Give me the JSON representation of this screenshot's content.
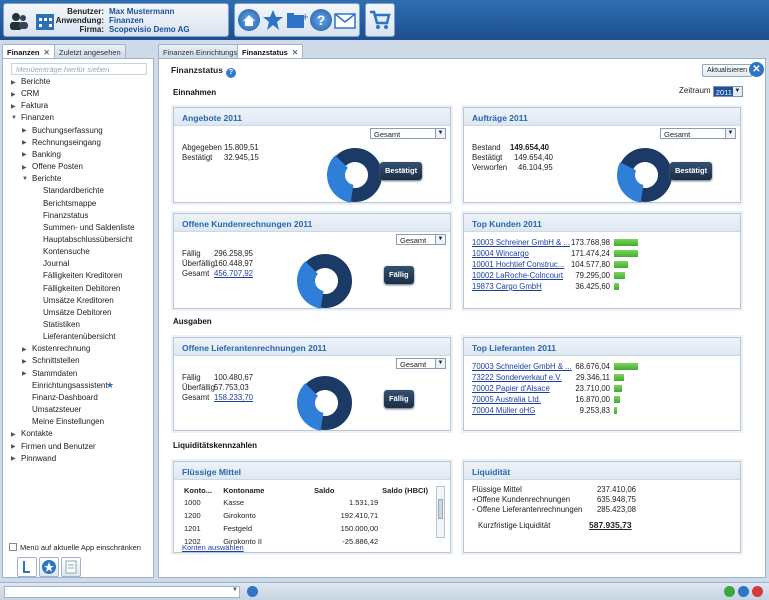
{
  "user": {
    "benutzer_label": "Benutzer:",
    "benutzer": "Max Mustermann",
    "anwendung_label": "Anwendung:",
    "anwendung": "Finanzen",
    "firma_label": "Firma:",
    "firma": "Scopevisio Demo AG"
  },
  "left_tabs": [
    {
      "label": "Finanzen",
      "active": true
    },
    {
      "label": "Zuletzt angesehen",
      "active": false
    }
  ],
  "main_tabs": [
    {
      "label": "Finanzen Einrichtungs...",
      "active": false
    },
    {
      "label": "Finanzstatus",
      "active": true
    }
  ],
  "menu": {
    "search_placeholder": "Menüeinträge hierfür sieben",
    "items": [
      {
        "label": "Berichte",
        "level": 0,
        "arrow": "right"
      },
      {
        "label": "CRM",
        "level": 0,
        "arrow": "right"
      },
      {
        "label": "Faktura",
        "level": 0,
        "arrow": "right"
      },
      {
        "label": "Finanzen",
        "level": 0,
        "arrow": "down"
      },
      {
        "label": "Buchungserfassung",
        "level": 1,
        "arrow": "right"
      },
      {
        "label": "Rechnungseingang",
        "level": 1,
        "arrow": "right"
      },
      {
        "label": "Banking",
        "level": 1,
        "arrow": "right"
      },
      {
        "label": "Offene Posten",
        "level": 1,
        "arrow": "right"
      },
      {
        "label": "Berichte",
        "level": 1,
        "arrow": "down"
      },
      {
        "label": "Standardberichte",
        "level": 2,
        "arrow": ""
      },
      {
        "label": "Berichtsmappe",
        "level": 2,
        "arrow": ""
      },
      {
        "label": "Finanzstatus",
        "level": 2,
        "arrow": "",
        "selected": true
      },
      {
        "label": "Summen- und Saldenliste",
        "level": 2,
        "arrow": ""
      },
      {
        "label": "Hauptabschlussübersicht",
        "level": 2,
        "arrow": ""
      },
      {
        "label": "Kontensuche",
        "level": 2,
        "arrow": ""
      },
      {
        "label": "Journal",
        "level": 2,
        "arrow": ""
      },
      {
        "label": "Fälligkeiten Kreditoren",
        "level": 2,
        "arrow": ""
      },
      {
        "label": "Fälligkeiten Debitoren",
        "level": 2,
        "arrow": ""
      },
      {
        "label": "Umsätze Kreditoren",
        "level": 2,
        "arrow": ""
      },
      {
        "label": "Umsätze Debitoren",
        "level": 2,
        "arrow": ""
      },
      {
        "label": "Statistiken",
        "level": 2,
        "arrow": ""
      },
      {
        "label": "Lieferantenübersicht",
        "level": 2,
        "arrow": ""
      },
      {
        "label": "Kostenrechnung",
        "level": 1,
        "arrow": "right"
      },
      {
        "label": "Schnittstellen",
        "level": 1,
        "arrow": "right"
      },
      {
        "label": "Stammdaten",
        "level": 1,
        "arrow": "right"
      },
      {
        "label": "Einrichtungsassistent",
        "level": 1,
        "arrow": "",
        "star": true
      },
      {
        "label": "Finanz-Dashboard",
        "level": 1,
        "arrow": ""
      },
      {
        "label": "Umsatzsteuer",
        "level": 1,
        "arrow": ""
      },
      {
        "label": "Meine Einstellungen",
        "level": 1,
        "arrow": ""
      },
      {
        "label": "Kontakte",
        "level": 0,
        "arrow": "right"
      },
      {
        "label": "Firmen und Benutzer",
        "level": 0,
        "arrow": "right"
      },
      {
        "label": "Pinnwand",
        "level": 0,
        "arrow": "right"
      }
    ],
    "restrict_label": "Menü auf aktuelle App einschränken"
  },
  "main": {
    "title": "Finanzstatus",
    "refresh_label": "Aktualisieren",
    "einnahmen": "Einnahmen",
    "ausgaben": "Ausgaben",
    "liquiditaet_header": "Liquiditätskennzahlen",
    "zeitraum_label": "Zeitraum",
    "zeitraum_value": "2011"
  },
  "angebote": {
    "title": "Angebote 2011",
    "dropdown": "Gesamt",
    "rows": [
      {
        "label": "Abgegeben",
        "value": "15.809,51"
      },
      {
        "label": "Bestätigt",
        "value": "32.945,15"
      }
    ],
    "badge": "Bestätigt",
    "donut_fraction": 0.35
  },
  "auftraege": {
    "title": "Aufträge 2011",
    "dropdown": "Gesamt",
    "rows": [
      {
        "label": "Bestand",
        "value": "149.654,40"
      },
      {
        "label": "Bestätigt",
        "value": "149.654,40"
      },
      {
        "label": "Verworfen",
        "value": "46.104,95"
      }
    ],
    "badge": "Bestätigt",
    "donut_fraction": 0.3
  },
  "kunden_rechnungen": {
    "title": "Offene Kundenrechnungen 2011",
    "dropdown": "Gesamt",
    "rows": [
      {
        "label": "Fällig",
        "value": "296.258,95"
      },
      {
        "label": "Überfällig",
        "value": "160.448,97"
      },
      {
        "label": "Gesamt",
        "value": "456.707,92"
      }
    ],
    "badge": "Fällig",
    "donut_fraction": 0.35
  },
  "top_kunden": {
    "title": "Top Kunden 2011",
    "rows": [
      {
        "name": "10003 Schreiner GmbH & ...",
        "value": "173.768,98",
        "amount": 173768.98
      },
      {
        "name": "10004 Wincargo",
        "value": "171.474,24",
        "amount": 171474.24
      },
      {
        "name": "10001 Hochtief Construc...",
        "value": "104.577,80",
        "amount": 104577.8
      },
      {
        "name": "10002 LaRoche-Colncourt",
        "value": "79.295,00",
        "amount": 79295.0
      },
      {
        "name": "19873 Cargo GmbH",
        "value": "36.425,60",
        "amount": 36425.6
      }
    ]
  },
  "lieferanten_rechnungen": {
    "title": "Offene Lieferantenrechnungen 2011",
    "dropdown": "Gesamt",
    "rows": [
      {
        "label": "Fällig",
        "value": "100.480,67"
      },
      {
        "label": "Überfällig",
        "value": "57.753,03"
      },
      {
        "label": "Gesamt",
        "value": "158.233,70"
      }
    ],
    "badge": "Fällig",
    "donut_fraction": 0.35
  },
  "top_lieferanten": {
    "title": "Top Lieferanten 2011",
    "rows": [
      {
        "name": "70003 Schneider GmbH & ...",
        "value": "68.676,04",
        "amount": 68676.04
      },
      {
        "name": "73222 Sonderverkauf e.V.",
        "value": "29.346,11",
        "amount": 29346.11
      },
      {
        "name": "70002 Papier d'Alsace",
        "value": "23.710,00",
        "amount": 23710.0
      },
      {
        "name": "70005 Australia Ltd.",
        "value": "16.870,00",
        "amount": 16870.0
      },
      {
        "name": "70004 Müller oHG",
        "value": "9.253,83",
        "amount": 9253.83
      }
    ]
  },
  "fluessige_mittel": {
    "title": "Flüssige Mittel",
    "columns": [
      "Konto...",
      "Kontoname",
      "Saldo",
      "Saldo (HBCI)"
    ],
    "rows": [
      [
        "1000",
        "Kasse",
        "1.531,19",
        ""
      ],
      [
        "1200",
        "Girokonto",
        "192.410,71",
        ""
      ],
      [
        "1201",
        "Festgeld",
        "150.000,00",
        ""
      ],
      [
        "1202",
        "Girokonto II",
        "-25.886,42",
        ""
      ]
    ],
    "link": "Konten auswählen"
  },
  "liquiditaet": {
    "title": "Liquidität",
    "rows": [
      {
        "label": "Flüssige Mittel",
        "value": "237.410,06"
      },
      {
        "label": "+Offene Kundenrechnungen",
        "value": "635.948,75"
      },
      {
        "label": "- Offene Lieferantenrechnungen",
        "value": "285.423,08"
      }
    ],
    "total_label": "Kurzfristige Liquidität",
    "total_value": "587.935,73"
  },
  "colors": {
    "accent": "#2767b4",
    "donut_dark": "#1b3a66",
    "donut_light": "#2f7fd8",
    "bar": "#4fbe39"
  }
}
